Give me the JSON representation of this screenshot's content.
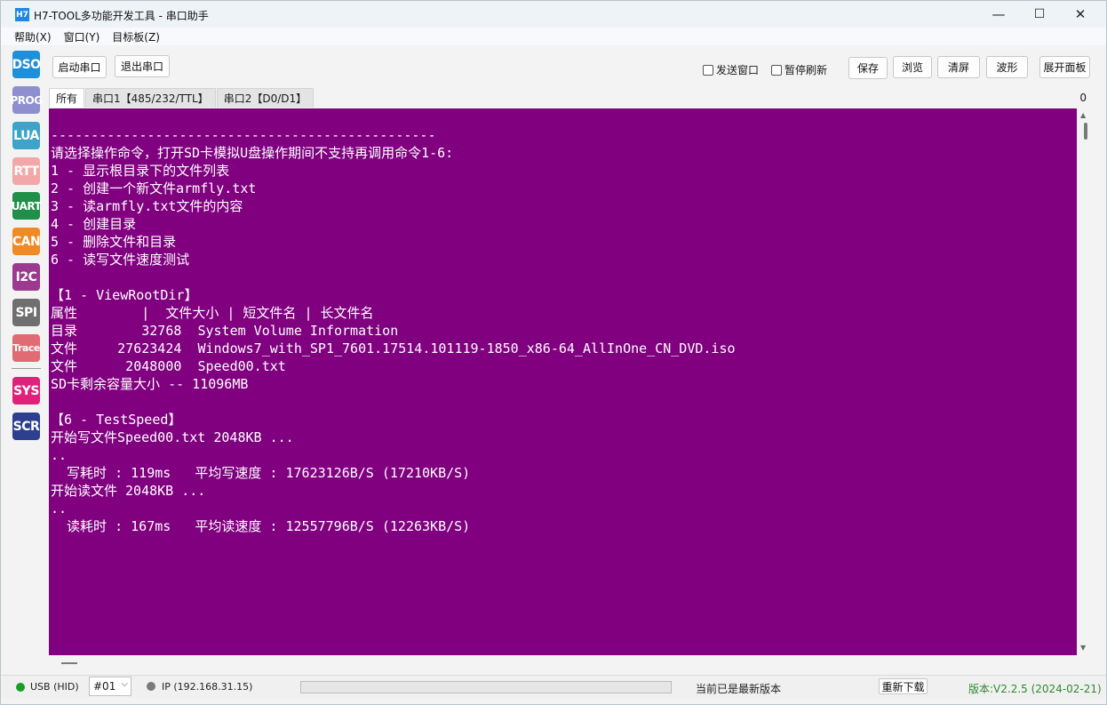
{
  "window": {
    "app_icon": "H7",
    "title": "H7-TOOL多功能开发工具 - 串口助手",
    "controls": {
      "minimize": "—",
      "maximize": "☐",
      "close": "✕"
    }
  },
  "menu": [
    "帮助(X)",
    "窗口(Y)",
    "目标板(Z)"
  ],
  "sidebar": [
    {
      "label": "DSO",
      "color": "#1e8fd8"
    },
    {
      "label": "PROG",
      "color": "#8f8fcf"
    },
    {
      "label": "LUA",
      "color": "#3fa3c8"
    },
    {
      "label": "RTT",
      "color": "#f2a8a8"
    },
    {
      "label": "UART",
      "color": "#1f8f4a"
    },
    {
      "label": "CAN",
      "color": "#f08a24"
    },
    {
      "label": "I2C",
      "color": "#9b3a8f"
    },
    {
      "label": "SPI",
      "color": "#6f6f6f"
    },
    {
      "label": "Trace",
      "color": "#e06b73"
    },
    {
      "label": "SYS",
      "color": "#e0207a"
    },
    {
      "label": "SCR",
      "color": "#2f3f8f"
    }
  ],
  "toolbar": {
    "start_port": "启动串口",
    "exit_port": "退出串口",
    "send_window": "发送窗口",
    "pause_refresh": "暂停刷新",
    "save": "保存",
    "browse": "浏览",
    "clear": "清屏",
    "waveform": "波形",
    "expand_panel": "展开面板"
  },
  "tabs": [
    "所有",
    "串口1【485/232/TTL】",
    "串口2【D0/D1】"
  ],
  "counter": "0",
  "console_lines": [
    "------------------------------------------------",
    "请选择操作命令，打开SD卡模拟U盘操作期间不支持再调用命令1-6:",
    "1 - 显示根目录下的文件列表",
    "2 - 创建一个新文件armfly.txt",
    "3 - 读armfly.txt文件的内容",
    "4 - 创建目录",
    "5 - 删除文件和目录",
    "6 - 读写文件速度测试",
    "",
    "【1 - ViewRootDir】",
    "属性        |  文件大小 | 短文件名 | 长文件名",
    "目录        32768  System Volume Information",
    "文件     27623424  Windows7_with_SP1_7601.17514.101119-1850_x86-64_AllInOne_CN_DVD.iso",
    "文件      2048000  Speed00.txt",
    "SD卡剩余容量大小 -- 11096MB",
    "",
    "【6 - TestSpeed】",
    "开始写文件Speed00.txt 2048KB ...",
    "..",
    "  写耗时 : 119ms   平均写速度 : 17623126B/S (17210KB/S)",
    "开始读文件 2048KB ...",
    "..",
    "  读耗时 : 167ms   平均读速度 : 12557796B/S (12263KB/S)"
  ],
  "status": {
    "usb": "USB (HID)",
    "usb_color": "#1a9b2a",
    "device": "#01",
    "ip": "IP (192.168.31.15)",
    "ip_color": "#7a7a7a",
    "latest": "当前已是最新版本",
    "redownload": "重新下载",
    "version": "版本:V2.2.5 (2024-02-21)",
    "version_color": "#2e8b2e"
  }
}
